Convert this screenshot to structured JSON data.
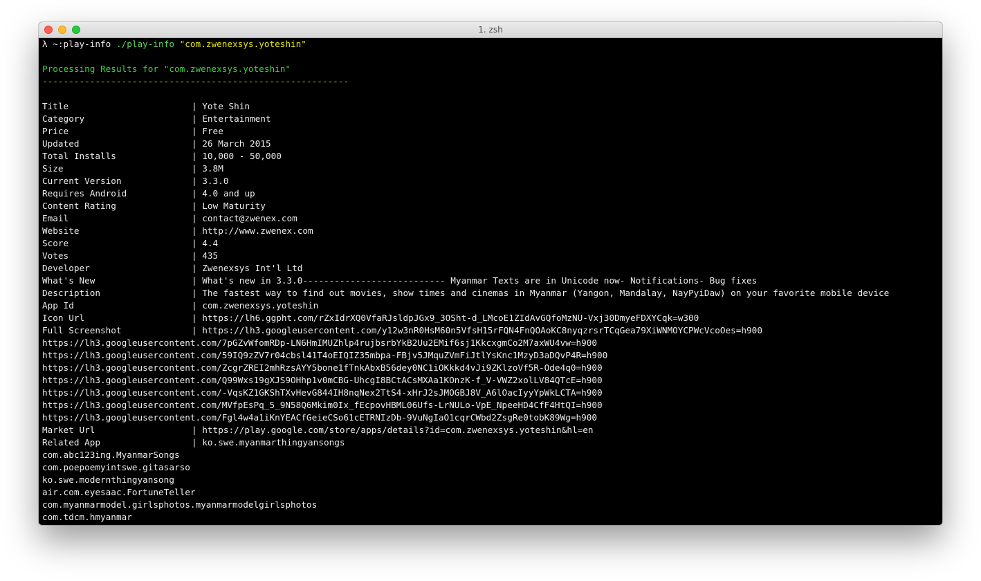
{
  "window": {
    "title": "1. zsh",
    "controls": [
      "close",
      "minimize",
      "zoom"
    ]
  },
  "prompt": {
    "symbol": "λ",
    "cwd": "~:play-info",
    "command": "./play-info",
    "argument": "\"com.zwenexsys.yoteshin\""
  },
  "header": "Processing Results for \"com.zwenexsys.yoteshin\"",
  "separator": "----------------------------------------------------------",
  "fields": [
    {
      "label": "Title",
      "value": "| Yote Shin"
    },
    {
      "label": "Category",
      "value": "| Entertainment"
    },
    {
      "label": "Price",
      "value": "| Free"
    },
    {
      "label": "Updated",
      "value": "| 26 March 2015"
    },
    {
      "label": "Total Installs",
      "value": "| 10,000 - 50,000"
    },
    {
      "label": "Size",
      "value": "| 3.8M"
    },
    {
      "label": "Current Version",
      "value": "| 3.3.0"
    },
    {
      "label": "Requires Android",
      "value": "| 4.0 and up"
    },
    {
      "label": "Content Rating",
      "value": "| Low Maturity"
    },
    {
      "label": "Email",
      "value": "| contact@zwenex.com"
    },
    {
      "label": "Website",
      "value": "| http://www.zwenex.com"
    },
    {
      "label": "Score",
      "value": "| 4.4"
    },
    {
      "label": "Votes",
      "value": "| 435"
    },
    {
      "label": "Developer",
      "value": "| Zwenexsys Int'l Ltd"
    },
    {
      "label": "What's New",
      "value": "| What's new in 3.3.0--------------------------- Myanmar Texts are in Unicode now- Notifications- Bug fixes"
    },
    {
      "label": "Description",
      "value": "| The fastest way to find out movies, show times and cinemas in Myanmar (Yangon, Mandalay, NayPyiDaw) on your favorite mobile device"
    },
    {
      "label": "App Id",
      "value": "| com.zwenexsys.yoteshin"
    },
    {
      "label": "Icon Url",
      "value": "| https://lh6.ggpht.com/rZxIdrXQ0VfaRJsldpJGx9_3OSht-d_LMcoE1ZIdAvGQfoMzNU-Vxj30DmyeFDXYCqk=w300"
    },
    {
      "label": "Full Screenshot",
      "value": "| https://lh3.googleusercontent.com/y12w3nR0HsM60n5VfsH15rFQN4FnQOAoKC8nyqzrsrTCqGea79XiWNMOYCPWcVcoOes=h900"
    }
  ],
  "screenshot_urls": [
    "https://lh3.googleusercontent.com/7pGZvWfomRDp-LN6HmIMUZhlp4rujbsrbYkB2Uu2EMif6sj1KkcxgmCo2M7axWU4vw=h900",
    "https://lh3.googleusercontent.com/59IQ9zZV7r04cbsl41T4oEIQIZ35mbpa-FBjv5JMquZVmFiJtlYsKnc1MzyD3aDQvP4R=h900",
    "https://lh3.googleusercontent.com/ZcgrZREI2mhRzsAYY5bone1fTnkAbxB56dey0NC1iOKkkd4vJi9ZKlzoVf5R-Ode4q0=h900",
    "https://lh3.googleusercontent.com/Q99Wxs19gXJS9OHhp1v0mCBG-UhcgI8BCtACsMXAa1KOnzK-f_V-VWZ2xolLV84QTcE=h900",
    "https://lh3.googleusercontent.com/-VqsKZ1GKShTXvHevG844IH8nqNex2TtS4-xHrJ2sJMOGBJ8V_A6lOacIyyYpWkLCTA=h900",
    "https://lh3.googleusercontent.com/MVfpEsPq_5_9N58Q6Mkim0Ix_fEcpovHBML06Ufs-LrNULo-VpE_NpeeHD4CfF4HtQI=h900",
    "https://lh3.googleusercontent.com/Fgl4w4a1iKnYEACfGeieCSo61cETRNIzDb-9VuNgIaO1cqrCWbd2ZsgRe0tobK89Wg=h900"
  ],
  "market": {
    "label": "Market Url",
    "value": "| https://play.google.com/store/apps/details?id=com.zwenexsys.yoteshin&hl=en"
  },
  "related": {
    "label": "Related App",
    "value": "| ko.swe.myanmarthingyansongs"
  },
  "related_apps": [
    "com.abc123ing.MyanmarSongs",
    "com.poepoemyintswe.gitasarso",
    "ko.swe.modernthingyansong",
    "air.com.eyesaac.FortuneTeller",
    "com.myanmarmodel.girlsphotos.myanmarmodelgirlsphotos",
    "com.tdcm.hmyanmar"
  ]
}
